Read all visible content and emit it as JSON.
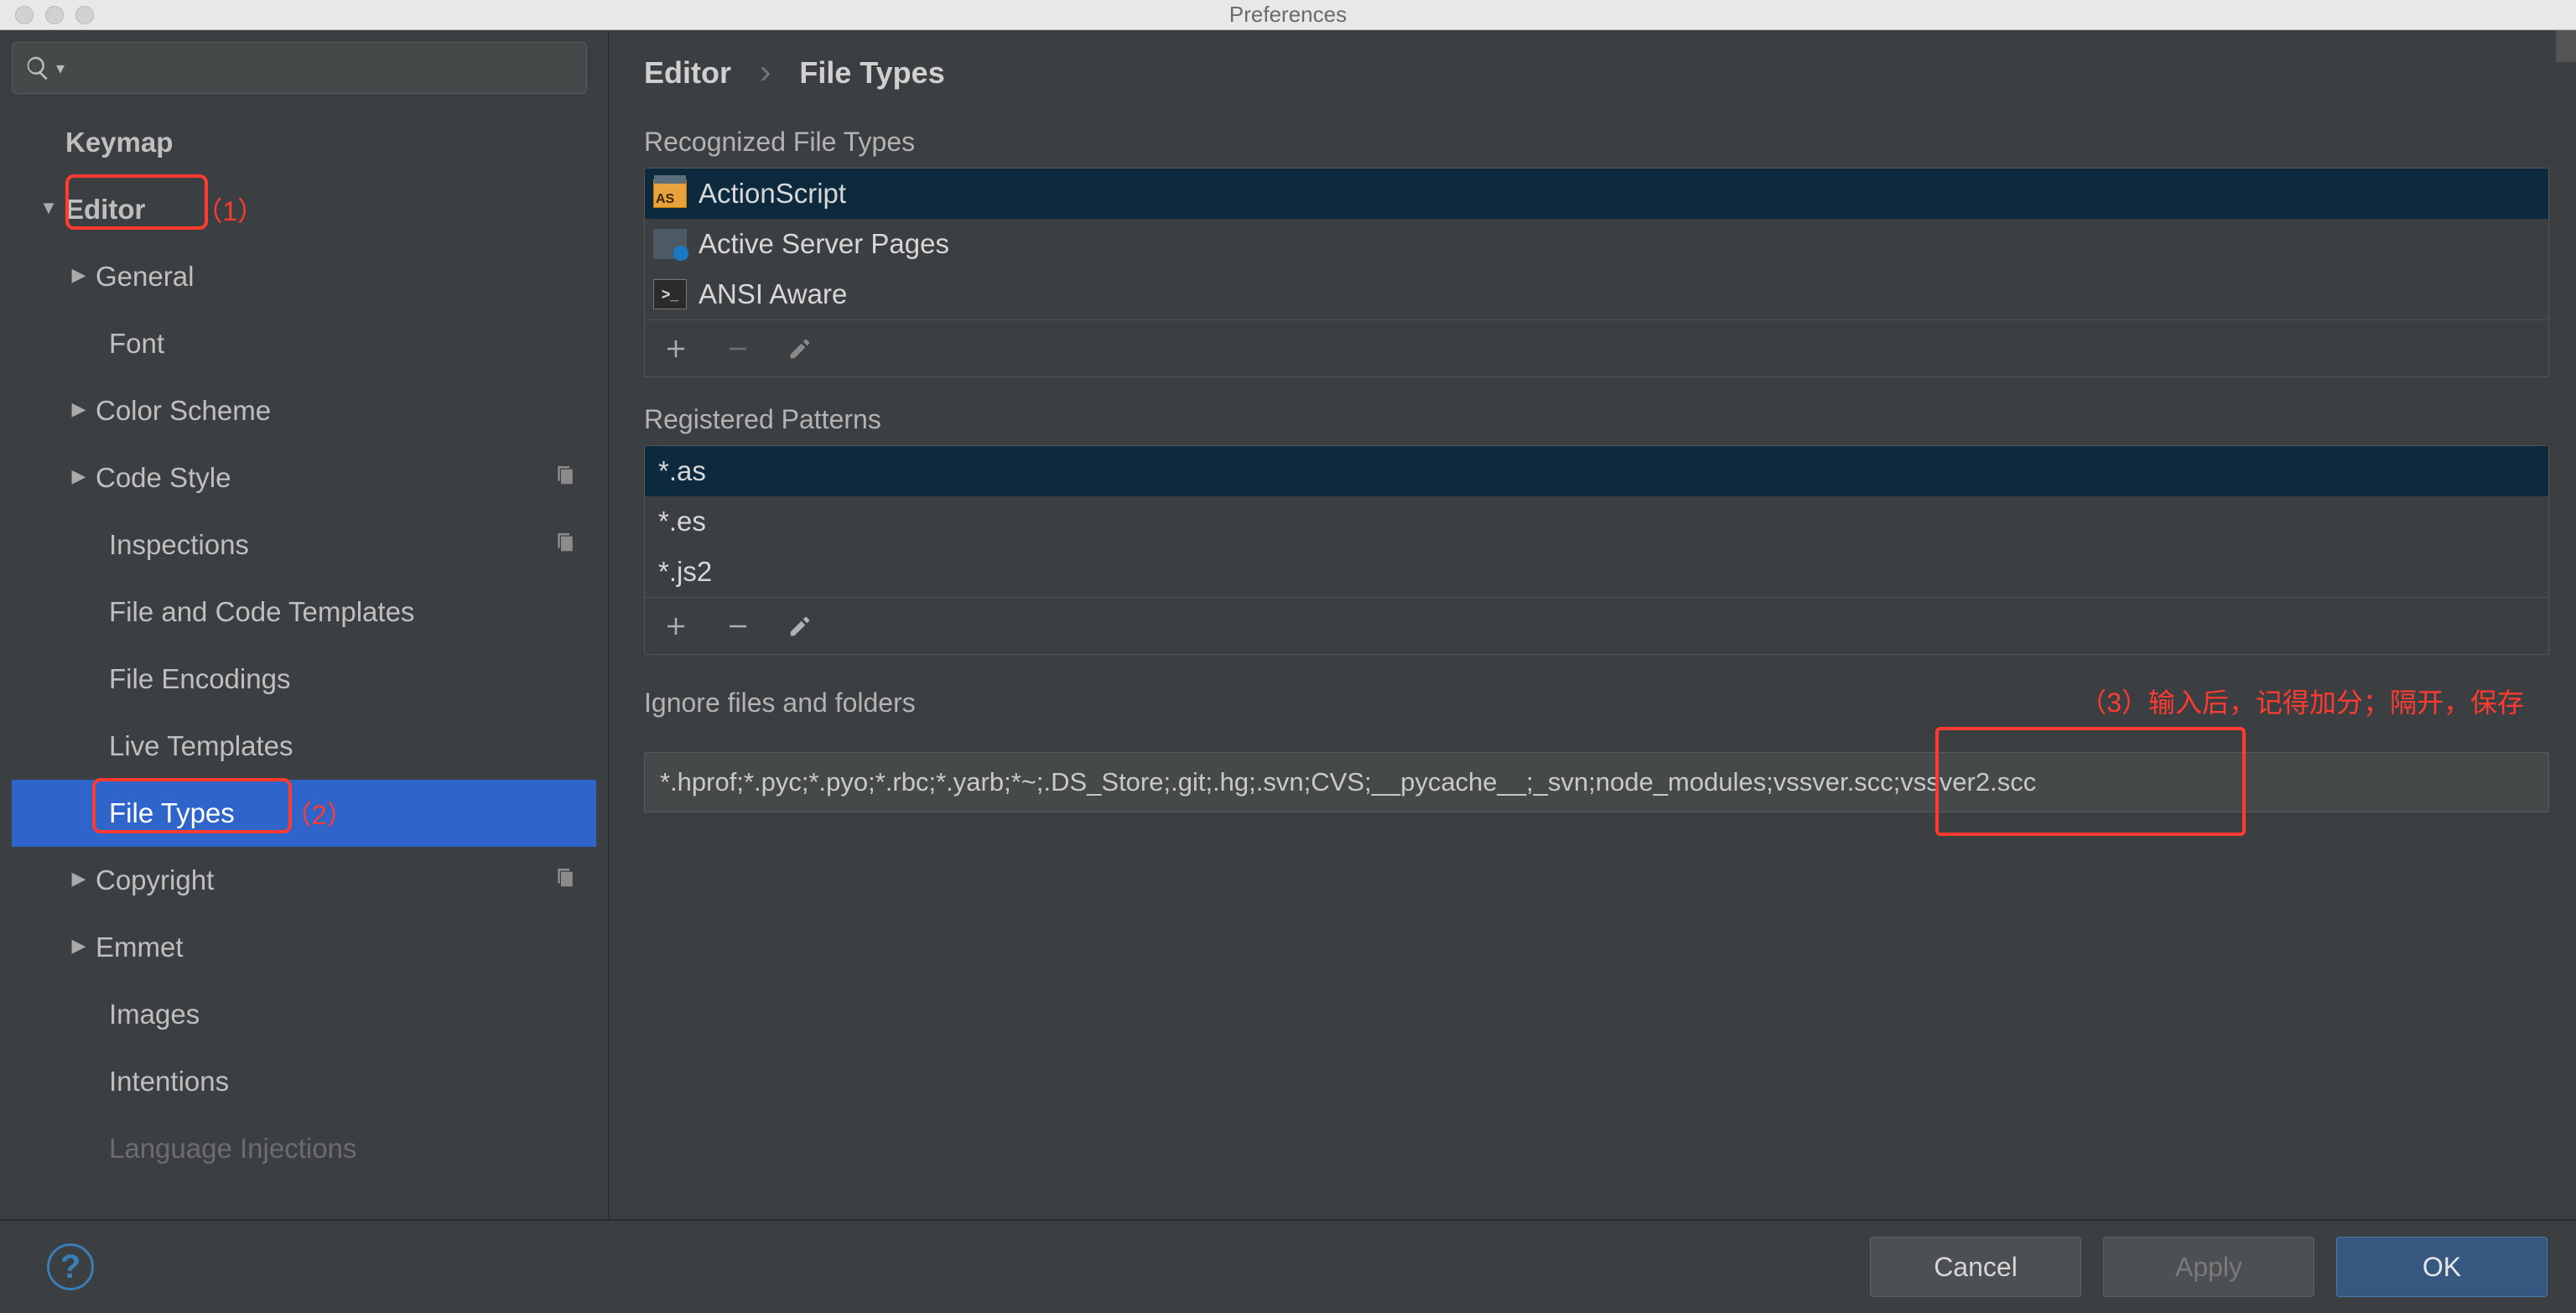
{
  "window": {
    "title": "Preferences"
  },
  "search": {
    "placeholder": ""
  },
  "sidebar": {
    "keymap": "Keymap",
    "editor": "Editor",
    "children": {
      "general": "General",
      "font": "Font",
      "colorScheme": "Color Scheme",
      "codeStyle": "Code Style",
      "inspections": "Inspections",
      "fileAndCodeTemplates": "File and Code Templates",
      "fileEncodings": "File Encodings",
      "liveTemplates": "Live Templates",
      "fileTypes": "File Types",
      "copyright": "Copyright",
      "emmet": "Emmet",
      "images": "Images",
      "intentions": "Intentions",
      "languageInjections": "Language Injections"
    }
  },
  "annotations": {
    "ann1": "（1）",
    "ann2": "（2）",
    "ann3": "（3）输入后，记得加分；隔开，保存"
  },
  "breadcrumb": {
    "editor": "Editor",
    "fileTypes": "File Types"
  },
  "sections": {
    "recognized": "Recognized File Types",
    "patterns": "Registered Patterns",
    "ignore": "Ignore files and folders"
  },
  "fileTypes": [
    {
      "label": "ActionScript",
      "icon": "as",
      "selected": true
    },
    {
      "label": "Active Server Pages",
      "icon": "asp",
      "selected": false
    },
    {
      "label": "ANSI Aware",
      "icon": "ansi",
      "selected": false
    }
  ],
  "patterns": [
    {
      "label": "*.as",
      "selected": true
    },
    {
      "label": "*.es",
      "selected": false
    },
    {
      "label": "*.js2",
      "selected": false
    }
  ],
  "ignore": {
    "value": "*.hprof;*.pyc;*.pyo;*.rbc;*.yarb;*~;.DS_Store;.git;.hg;.svn;CVS;__pycache__;_svn;node_modules;vssver.scc;vssver2.scc"
  },
  "footer": {
    "cancel": "Cancel",
    "apply": "Apply",
    "ok": "OK"
  }
}
